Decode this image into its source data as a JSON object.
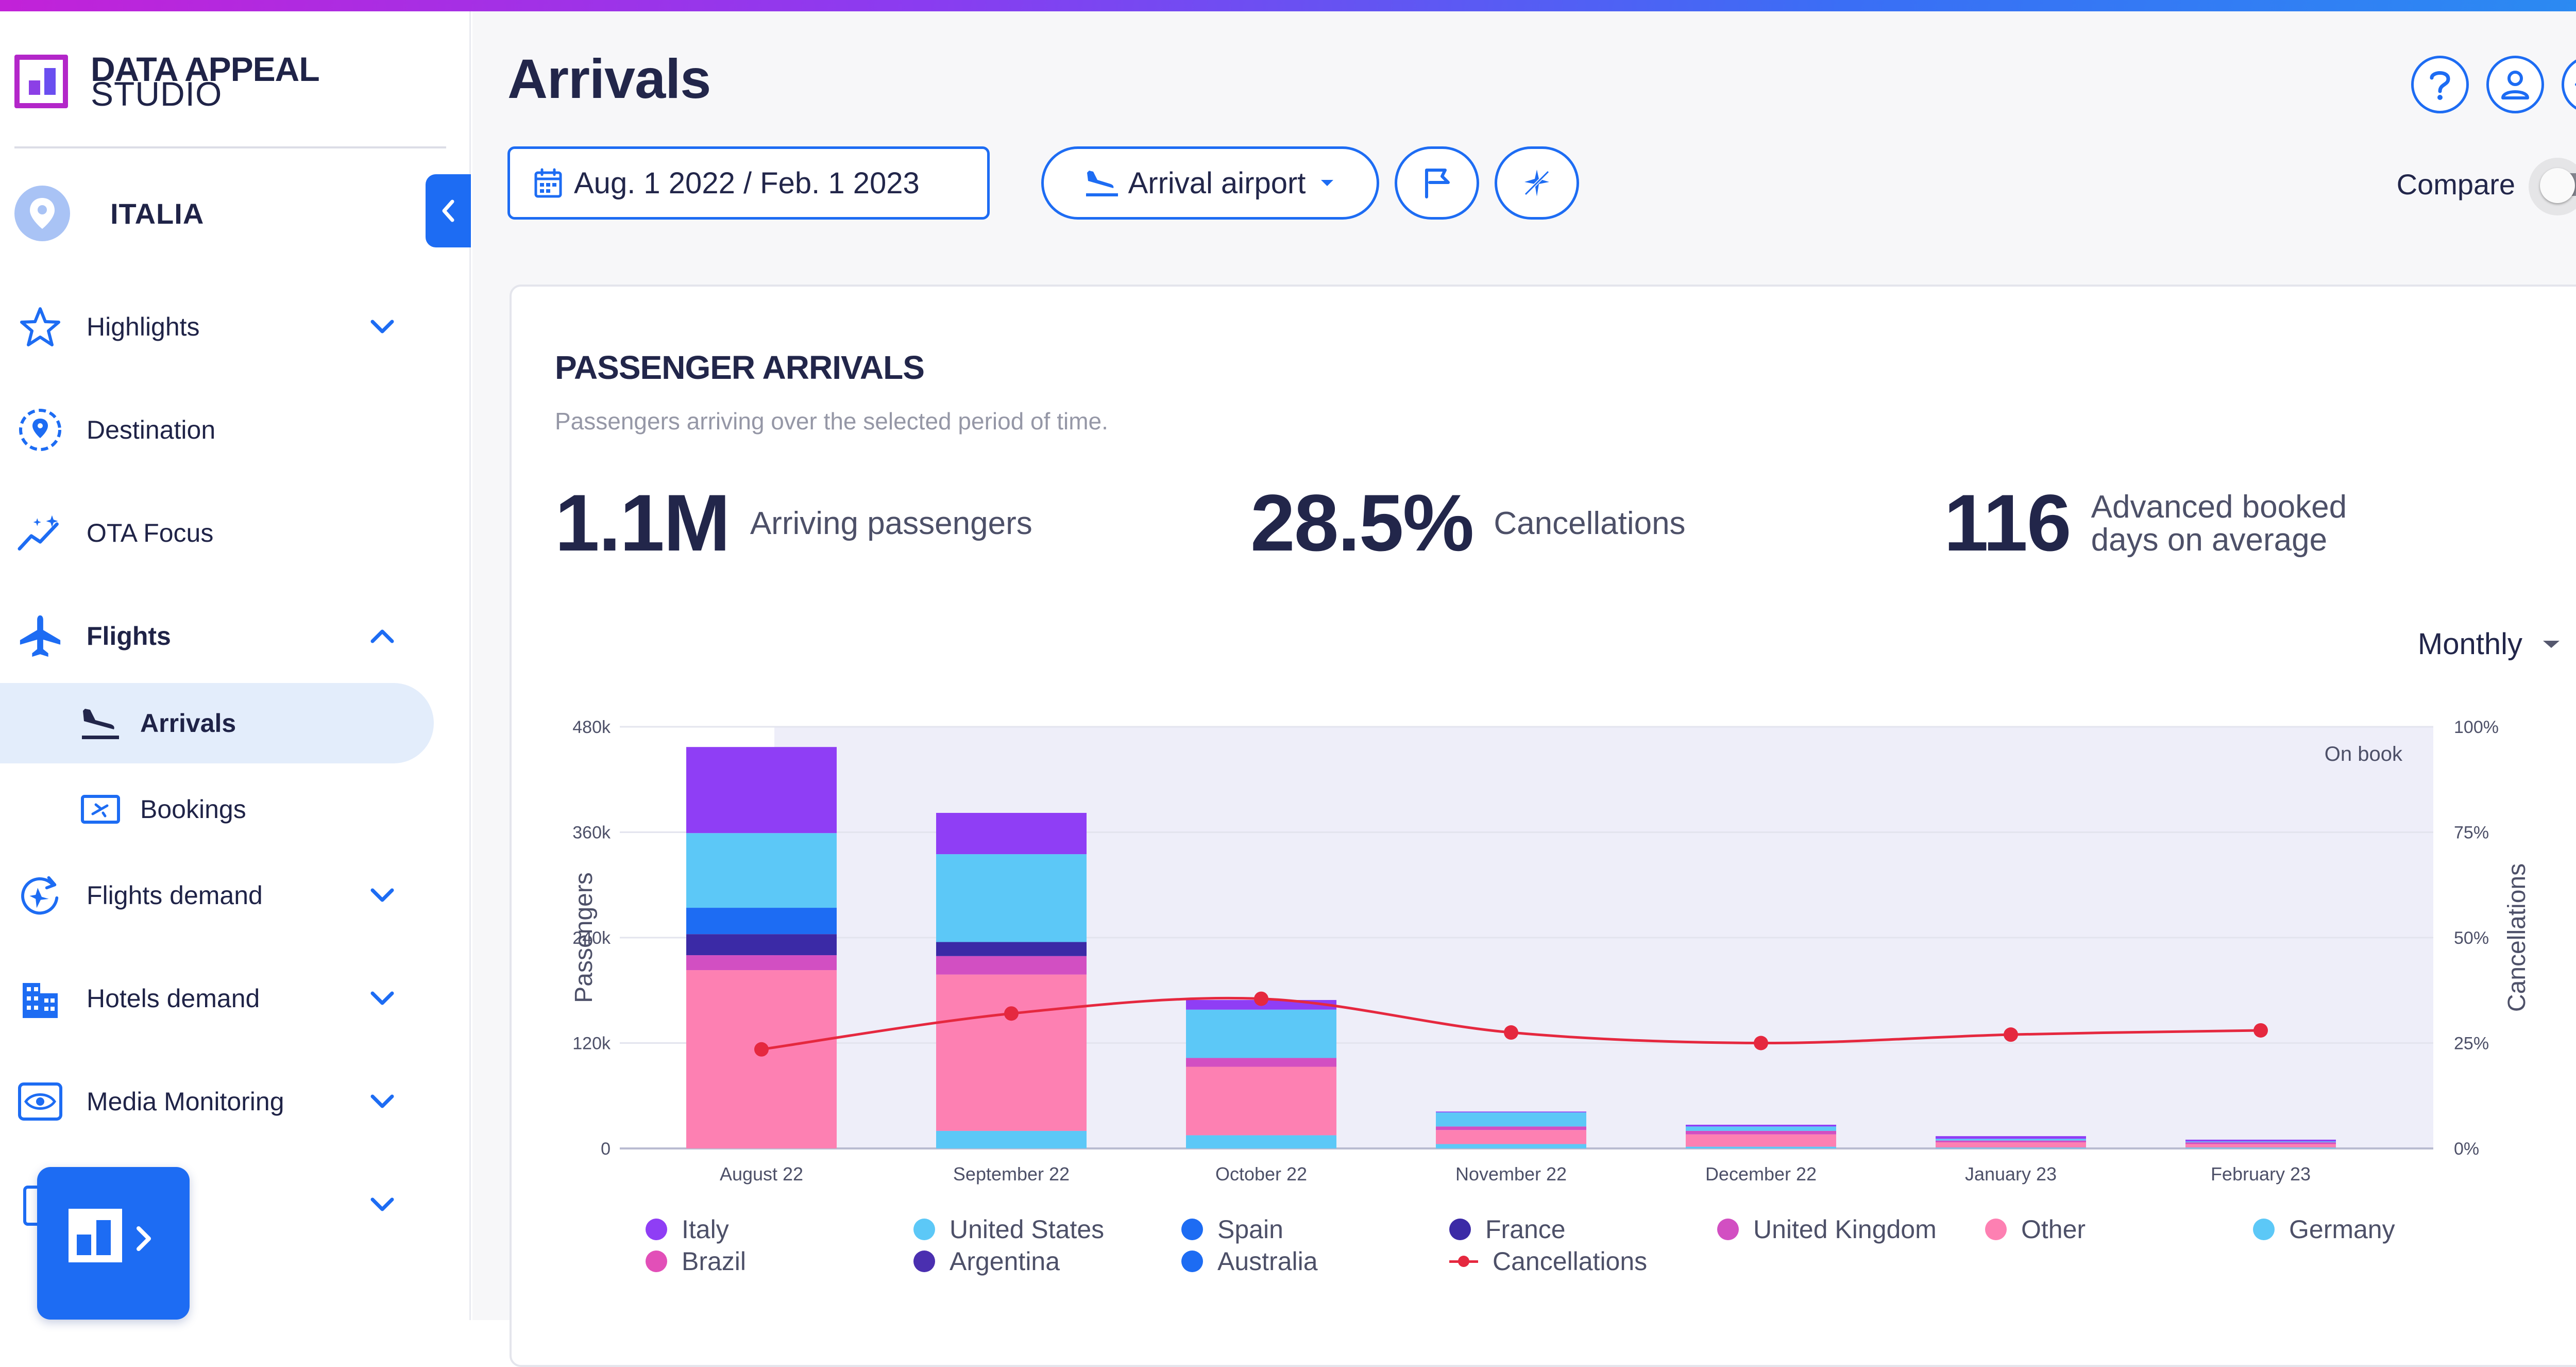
{
  "brand": {
    "line1": "DATA APPEAL",
    "line2": "STUDIO"
  },
  "region": {
    "label": "ITALIA"
  },
  "sidebar": {
    "items": [
      {
        "label": "Highlights"
      },
      {
        "label": "Destination"
      },
      {
        "label": "OTA Focus"
      },
      {
        "label": "Flights"
      },
      {
        "label": "Arrivals"
      },
      {
        "label": "Bookings"
      },
      {
        "label": "Flights demand"
      },
      {
        "label": "Hotels demand"
      },
      {
        "label": "Media Monitoring"
      }
    ]
  },
  "page": {
    "title": "Arrivals"
  },
  "filters": {
    "date_range": "Aug. 1 2022 / Feb. 1 2023",
    "airport": "Arrival airport",
    "compare_label": "Compare",
    "compare_on": false
  },
  "card": {
    "title": "PASSENGER ARRIVALS",
    "subtitle": "Passengers arriving over the selected period of time.",
    "kpis": [
      {
        "value": "1.1M",
        "label": "Arriving passengers"
      },
      {
        "value": "28.5%",
        "label": "Cancellations"
      },
      {
        "value": "116",
        "label_line1": "Advanced booked",
        "label_line2": "days on average"
      }
    ],
    "granularity": "Monthly"
  },
  "colors": {
    "accent": "#1d6cf3",
    "Italy": "#8f3ef5",
    "United States": "#5cc8f7",
    "Spain": "#1d6cf3",
    "France": "#3b2aa6",
    "United Kingdom": "#d24fc2",
    "Other": "#fd80b2",
    "Germany": "#5cc8f7",
    "Brazil": "#e24fb8",
    "Argentina": "#4a2fb0",
    "Australia": "#1d6cf3",
    "Cancellations": "#e5283f"
  },
  "chart_data": {
    "type": "bar",
    "stacked": true,
    "categories": [
      "August 22",
      "September 22",
      "October 22",
      "November 22",
      "December 22",
      "January 23",
      "February 23"
    ],
    "ylabel": "Passengers",
    "y2label": "Cancellations",
    "ylim": [
      0,
      480000
    ],
    "y2lim": [
      0,
      100
    ],
    "yticks": [
      "0",
      "120k",
      "240k",
      "360k",
      "480k"
    ],
    "y2ticks": [
      "0%",
      "25%",
      "50%",
      "75%",
      "100%"
    ],
    "annotation": "On book",
    "series": [
      {
        "name": "Germany",
        "values": [
          0,
          20000,
          15000,
          5000,
          2000,
          1000,
          1000
        ]
      },
      {
        "name": "Other",
        "values": [
          203000,
          178000,
          78000,
          16000,
          14000,
          6000,
          4000
        ]
      },
      {
        "name": "United Kingdom",
        "values": [
          17000,
          21000,
          10000,
          4000,
          4000,
          2000,
          2000
        ]
      },
      {
        "name": "France",
        "values": [
          24000,
          16000,
          0,
          0,
          0,
          0,
          0
        ]
      },
      {
        "name": "Spain",
        "values": [
          30000,
          0,
          0,
          0,
          0,
          0,
          0
        ]
      },
      {
        "name": "United States",
        "values": [
          85000,
          100000,
          55000,
          16000,
          5000,
          2000,
          1000
        ]
      },
      {
        "name": "Italy",
        "values": [
          98000,
          47000,
          11000,
          1000,
          2000,
          3000,
          2000
        ]
      },
      {
        "name": "Brazil",
        "values": [
          0,
          0,
          0,
          0,
          0,
          0,
          0
        ]
      },
      {
        "name": "Argentina",
        "values": [
          0,
          0,
          0,
          0,
          0,
          0,
          0
        ]
      },
      {
        "name": "Australia",
        "values": [
          0,
          0,
          0,
          0,
          0,
          0,
          0
        ]
      }
    ],
    "line": {
      "name": "Cancellations",
      "values": [
        23.5,
        32,
        35.5,
        27.5,
        25,
        27,
        28
      ]
    },
    "legend": [
      "Italy",
      "United States",
      "Spain",
      "France",
      "United Kingdom",
      "Other",
      "Germany",
      "Brazil",
      "Argentina",
      "Australia",
      "Cancellations"
    ],
    "grid": true,
    "legend_position": "bottom"
  }
}
